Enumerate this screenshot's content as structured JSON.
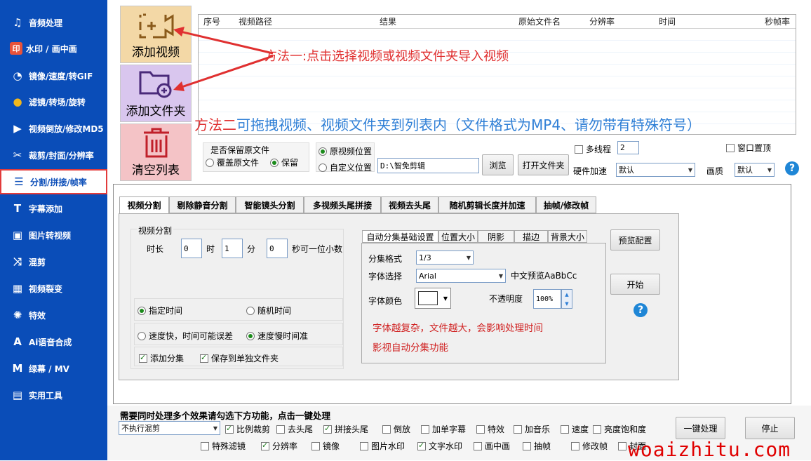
{
  "sidebar": {
    "items": [
      {
        "label": "音频处理",
        "icon": "music-note-icon"
      },
      {
        "label": "水印 / 画中画",
        "icon": "watermark-icon"
      },
      {
        "label": "镜像/速度/转GIF",
        "icon": "mirror-speed-icon"
      },
      {
        "label": "滤镜/转场/旋转",
        "icon": "filter-icon"
      },
      {
        "label": "视频倒放/修改MD5",
        "icon": "reverse-icon"
      },
      {
        "label": "裁剪/封面/分辨率",
        "icon": "scissors-icon"
      },
      {
        "label": "分割/拼接/帧率",
        "icon": "split-icon"
      },
      {
        "label": "字幕添加",
        "icon": "subtitle-icon"
      },
      {
        "label": "图片转视频",
        "icon": "image-video-icon"
      },
      {
        "label": "混剪",
        "icon": "shuffle-icon"
      },
      {
        "label": "视频裂变",
        "icon": "fission-icon"
      },
      {
        "label": "特效",
        "icon": "effects-icon"
      },
      {
        "label": "Ai语音合成",
        "icon": "ai-voice-icon"
      },
      {
        "label": "绿幕 / MV",
        "icon": "mv-icon"
      },
      {
        "label": "实用工具",
        "icon": "toolbox-icon"
      }
    ],
    "active_index": 6
  },
  "actions": {
    "add_video": "添加视频",
    "add_folder": "添加文件夹",
    "clear_list": "清空列表"
  },
  "table": {
    "columns": [
      "序号",
      "视频路径",
      "结果",
      "原始文件名",
      "分辨率",
      "时间",
      "秒帧率"
    ]
  },
  "annotations": {
    "method1": "方法一:点击选择视频或视频文件夹导入视频",
    "method2_prefix": "方法二",
    "method2_rest": "可拖拽视频、视频文件夹到列表内（文件格式为MP4、请勿带有特殊符号）"
  },
  "options": {
    "keep_source_label": "是否保留原文件",
    "overwrite": "覆盖原文件",
    "keep": "保留",
    "orig_location": "原视频位置",
    "custom_location": "自定义位置",
    "path": "D:\\智免剪辑",
    "browse": "浏览",
    "open_folder": "打开文件夹",
    "multithread": "多线程",
    "threads": "2",
    "hw_accel": "硬件加速",
    "hw_value": "默认",
    "window_top": "窗口置顶",
    "quality": "画质",
    "quality_value": "默认"
  },
  "tabs": [
    "视频分割",
    "剔除静音分割",
    "智能镜头分割",
    "多视频头尾拼接",
    "视频去头尾",
    "随机剪辑长度并加速",
    "抽帧/修改帧"
  ],
  "split": {
    "group_title": "视频分割",
    "duration": "时长",
    "hours": "0",
    "hour_unit": "时",
    "minutes": "1",
    "minute_unit": "分",
    "seconds": "0",
    "second_unit": "秒可一位小数",
    "fixed_time": "指定时间",
    "random_time": "随机时间",
    "fast_speed": "速度快，时间可能误差",
    "slow_speed": "速度慢时间准",
    "add_episode": "添加分集",
    "save_separate": "保存到单独文件夹"
  },
  "subtabs": [
    "自动分集基础设置",
    "位置大小",
    "阴影",
    "描边",
    "背景大小"
  ],
  "episode": {
    "format_label": "分集格式",
    "format_value": "1/3",
    "font_label": "字体选择",
    "font_value": "Arial",
    "preview": "中文预览AaBbCc",
    "color_label": "字体颜色",
    "opacity_label": "不透明度",
    "opacity_value": "100%",
    "note1": "字体越复杂，文件越大，会影响处理时间",
    "note2": "影视自动分集功能"
  },
  "side_buttons": {
    "preview_config": "预览配置",
    "start": "开始"
  },
  "bottom": {
    "title": "需要同时处理多个效果请勾选下方功能，点击一键处理",
    "mix_select": "不执行混剪",
    "row1": [
      {
        "label": "比例裁剪",
        "checked": true
      },
      {
        "label": "去头尾",
        "checked": false
      },
      {
        "label": "拼接头尾",
        "checked": true
      },
      {
        "label": "倒放",
        "checked": false
      },
      {
        "label": "加单字幕",
        "checked": false
      },
      {
        "label": "特效",
        "checked": false
      },
      {
        "label": "加音乐",
        "checked": false
      },
      {
        "label": "速度",
        "checked": false
      },
      {
        "label": "亮度饱和度",
        "checked": false
      }
    ],
    "row2": [
      {
        "label": "特殊滤镜",
        "checked": false
      },
      {
        "label": "分辨率",
        "checked": true
      },
      {
        "label": "镜像",
        "checked": false
      },
      {
        "label": "图片水印",
        "checked": false
      },
      {
        "label": "文字水印",
        "checked": true
      },
      {
        "label": "画中画",
        "checked": false
      },
      {
        "label": "抽帧",
        "checked": false
      },
      {
        "label": "修改帧",
        "checked": false
      },
      {
        "label": "封面",
        "checked": false
      }
    ],
    "one_click": "一键处理",
    "stop": "停止"
  },
  "watermark": "woaizhitu.com",
  "colors": {
    "sidebar": "#0a4db8",
    "annotation_red": "#e03030",
    "annotation_blue": "#2f7fd6"
  }
}
